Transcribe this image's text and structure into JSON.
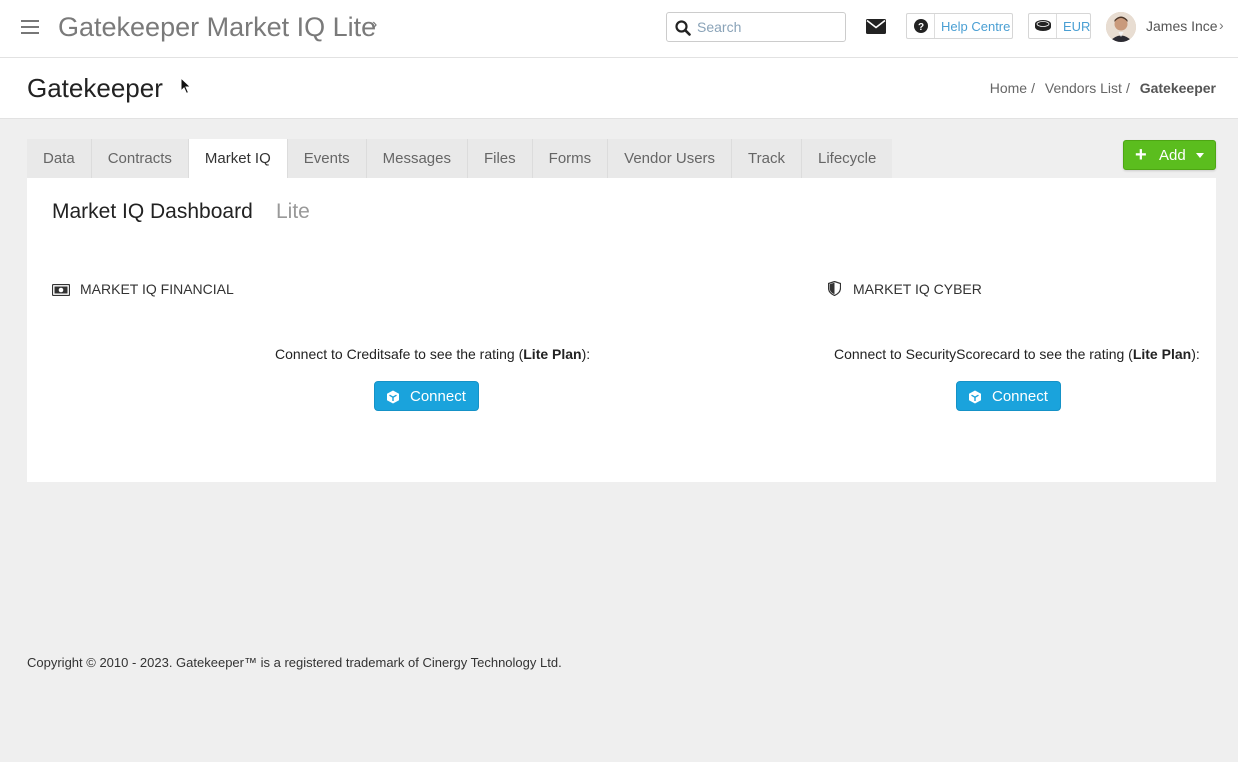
{
  "topbar": {
    "app_title": "Gatekeeper Market IQ Lite",
    "search_placeholder": "Search",
    "help_label": "Help Centre",
    "currency_label": "EUR",
    "user_name": "James Ince"
  },
  "page": {
    "title": "Gatekeeper",
    "breadcrumb": {
      "home": "Home",
      "vendors": "Vendors List",
      "current": "Gatekeeper"
    }
  },
  "tabs": [
    {
      "label": "Data"
    },
    {
      "label": "Contracts"
    },
    {
      "label": "Market IQ",
      "active": true
    },
    {
      "label": "Events"
    },
    {
      "label": "Messages"
    },
    {
      "label": "Files"
    },
    {
      "label": "Forms"
    },
    {
      "label": "Vendor Users"
    },
    {
      "label": "Track"
    },
    {
      "label": "Lifecycle"
    }
  ],
  "add_button": {
    "label": "Add"
  },
  "dashboard": {
    "title": "Market IQ Dashboard",
    "subtitle": "Lite",
    "financial": {
      "label": "MARKET IQ FINANCIAL",
      "connect_text": "Connect to Creditsafe to see the rating (",
      "plan": "Lite Plan",
      "connect_text_end": "):",
      "button": "Connect"
    },
    "cyber": {
      "label": "MARKET IQ CYBER",
      "connect_text": "Connect to SecurityScorecard to see the rating (",
      "plan": "Lite Plan",
      "connect_text_end": "):",
      "button": "Connect"
    }
  },
  "footer": {
    "copyright": "Copyright © 2010 - 2023. Gatekeeper™ is a registered trademark of Cinergy Technology Ltd."
  },
  "colors": {
    "accent": "#1aa3dc",
    "add_green": "#5bbd1e",
    "link": "#4a9fd3"
  }
}
